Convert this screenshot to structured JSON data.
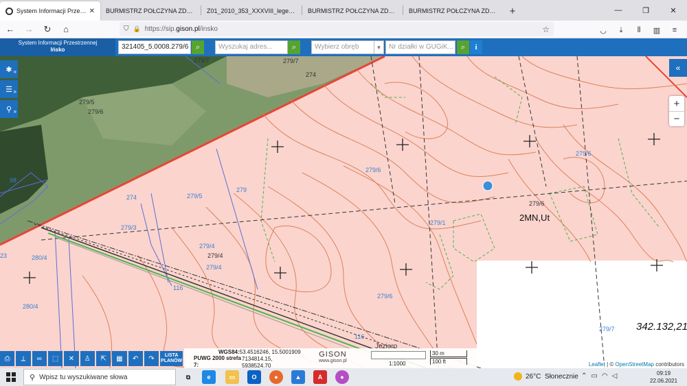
{
  "browser": {
    "tabs": [
      {
        "label": "System Informacji Przestrzennej",
        "active": true
      },
      {
        "label": "BURMISTRZ POŁCZYNA ZDROJU - U",
        "active": false
      },
      {
        "label": "Z01_2010_353_XXXVIII_legenda.jpg",
        "active": false
      },
      {
        "label": "BURMISTRZ POŁCZYNA ZDROJU - U",
        "active": false
      },
      {
        "label": "BURMISTRZ POŁCZYNA ZDROJU - U",
        "active": false
      }
    ],
    "new_tab": "+",
    "url_prefix": "https://sip.",
    "url_domain": "gison.pl",
    "url_path": "/insko"
  },
  "sip": {
    "title": "System Informacji Przestrzennej",
    "city": "Ińsko",
    "parcel_value": "321405_5.0008.279/6 (S",
    "address_placeholder": "Wyszukaj adres...",
    "district_placeholder": "Wybierz obręb",
    "parcel_number_placeholder": "Nr działki w GUGiK...",
    "info_label": "i"
  },
  "map": {
    "labels": {
      "l279_7a": "279/7",
      "l279_7b": "279/7",
      "l274a": "274",
      "l279_5a": "279/5",
      "l279_6a": "279/6",
      "l279_6b": "279/6",
      "l279_6c": "279/6",
      "l279_6d": "279/6",
      "l279_6e": "279/6",
      "l279_1": "279/1",
      "l274b": "274",
      "l279_5b": "279/5",
      "l279": "279",
      "l279_4a": "279/4",
      "l279_4b": "279/4",
      "l279_4c": "279/4",
      "l279_3": "279/3",
      "l279_7c": "279/7",
      "l116a": "116",
      "l116b": "116",
      "l280_4a": "280/4",
      "l280_4b": "280/4",
      "l98": "98",
      "l23": "23",
      "zoning": "2MN,Ut",
      "coordinate": "342.132,21",
      "lake": "Jezioro"
    },
    "zoom_in": "+",
    "zoom_out": "−",
    "attribution_leaflet": "Leaflet",
    "attribution_sep": " | © ",
    "attribution_osm": "OpenStreetMap",
    "attribution_rest": " contributors"
  },
  "status": {
    "wgs_label": "WGS84:",
    "wgs_value": "53.4516246, 15.5001909",
    "puwg_label": "PUWG 2000 strefa",
    "puwg_x": "7134814.15,",
    "seven_label": "7:",
    "puwg_y": "5938524.70",
    "logo": "GISON",
    "logo_url": "www.gison.pl",
    "scale_ratio": "1:1000",
    "scale_m": "30 m",
    "scale_ft": "100 ft",
    "lista_planow": "LISTA PLANÓW"
  },
  "taskbar": {
    "search_text": "Wpisz tu wyszukiwane słowa",
    "temperature": "26°C",
    "weather": "Słonecznie",
    "time": "09:19",
    "date": "22.06.2021"
  },
  "colors": {
    "sip_blue": "#1f6fbf",
    "search_green": "#56a332",
    "parcel_fill": "#fbd4cd",
    "contour": "#d87a50",
    "boundary_red": "#e84535"
  }
}
